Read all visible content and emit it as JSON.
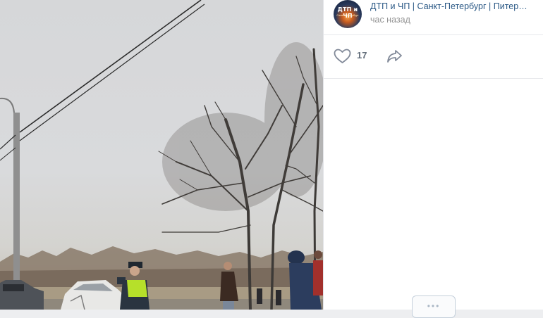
{
  "post": {
    "group_name": "ДТП и ЧП | Санкт-Петербург | Питер онлайн | СПб",
    "avatar_title": "ДТП и ЧП",
    "avatar_subtitle": "Санкт-Петербург",
    "time": "час назад",
    "likes_count": "17",
    "icons": {
      "like": "heart-icon",
      "share": "share-arrow-icon",
      "comment": "comment-dots-icon"
    }
  },
  "colors": {
    "link": "#2a5885",
    "muted": "#939393",
    "icon": "#828a99",
    "panel_bg": "#ffffff"
  }
}
